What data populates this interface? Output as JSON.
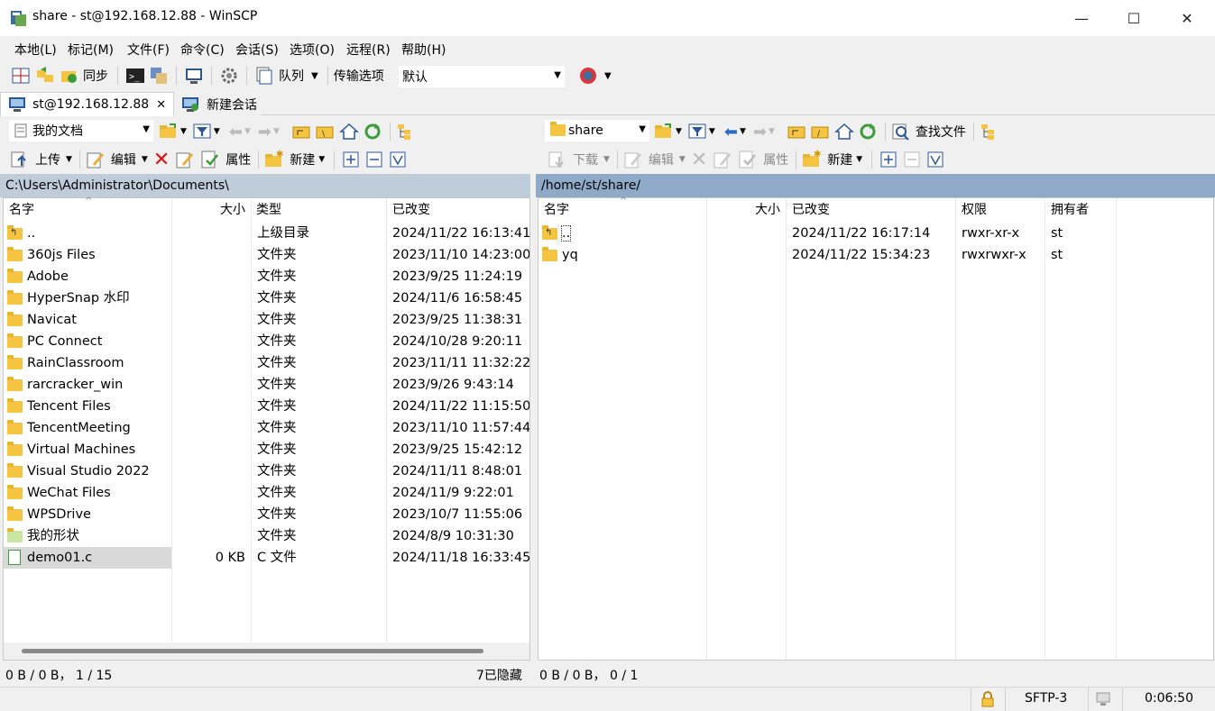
{
  "window": {
    "title": "share - st@192.168.12.88 - WinSCP",
    "minimize": "—",
    "maximize": "☐",
    "close": "✕"
  },
  "menu": [
    "本地(L)",
    "标记(M)",
    "文件(F)",
    "命令(C)",
    "会话(S)",
    "选项(O)",
    "远程(R)",
    "帮助(H)"
  ],
  "toolbar": {
    "sync": "同步",
    "queue": "队列",
    "transfer_label": "传输选项",
    "transfer_value": "默认"
  },
  "tabs": {
    "session": "st@192.168.12.88",
    "session_close": "✕",
    "new_session": "新建会话"
  },
  "local": {
    "combo": "我的文档",
    "upload": "上传",
    "edit": "编辑",
    "props": "属性",
    "new": "新建",
    "path": "C:\\Users\\Administrator\\Documents\\",
    "columns": {
      "name": "名字",
      "size": "大小",
      "type": "类型",
      "changed": "已改变"
    },
    "rows": [
      {
        "name": "..",
        "size": "",
        "type": "上级目录",
        "changed": "2024/11/22  16:13:41",
        "icon": "parent-dir"
      },
      {
        "name": "360js Files",
        "size": "",
        "type": "文件夹",
        "changed": "2023/11/10  14:23:00",
        "icon": "folder"
      },
      {
        "name": "Adobe",
        "size": "",
        "type": "文件夹",
        "changed": "2023/9/25  11:24:19",
        "icon": "folder"
      },
      {
        "name": "HyperSnap 水印",
        "size": "",
        "type": "文件夹",
        "changed": "2024/11/6  16:58:45",
        "icon": "folder"
      },
      {
        "name": "Navicat",
        "size": "",
        "type": "文件夹",
        "changed": "2023/9/25  11:38:31",
        "icon": "folder"
      },
      {
        "name": "PC Connect",
        "size": "",
        "type": "文件夹",
        "changed": "2024/10/28  9:20:11",
        "icon": "folder"
      },
      {
        "name": "RainClassroom",
        "size": "",
        "type": "文件夹",
        "changed": "2023/11/11  11:32:22",
        "icon": "folder"
      },
      {
        "name": "rarcracker_win",
        "size": "",
        "type": "文件夹",
        "changed": "2023/9/26  9:43:14",
        "icon": "folder"
      },
      {
        "name": "Tencent Files",
        "size": "",
        "type": "文件夹",
        "changed": "2024/11/22  11:15:50",
        "icon": "folder"
      },
      {
        "name": "TencentMeeting",
        "size": "",
        "type": "文件夹",
        "changed": "2023/11/10  11:57:44",
        "icon": "folder"
      },
      {
        "name": "Virtual Machines",
        "size": "",
        "type": "文件夹",
        "changed": "2023/9/25  15:42:12",
        "icon": "folder"
      },
      {
        "name": "Visual Studio 2022",
        "size": "",
        "type": "文件夹",
        "changed": "2024/11/11  8:48:01",
        "icon": "folder"
      },
      {
        "name": "WeChat Files",
        "size": "",
        "type": "文件夹",
        "changed": "2024/11/9  9:22:01",
        "icon": "folder"
      },
      {
        "name": "WPSDrive",
        "size": "",
        "type": "文件夹",
        "changed": "2023/10/7  11:55:06",
        "icon": "folder"
      },
      {
        "name": "我的形状",
        "size": "",
        "type": "文件夹",
        "changed": "2024/8/9  10:31:30",
        "icon": "special-folder"
      },
      {
        "name": "demo01.c",
        "size": "0 KB",
        "type": "C 文件",
        "changed": "2024/11/18  16:33:45",
        "icon": "c-file"
      }
    ],
    "status_left": "0 B / 0 B， 1 / 15",
    "status_right": "7已隐藏"
  },
  "remote": {
    "combo": "share",
    "download": "下载",
    "edit": "编辑",
    "props": "属性",
    "new": "新建",
    "find": "查找文件",
    "path": "/home/st/share/",
    "columns": {
      "name": "名字",
      "size": "大小",
      "changed": "已改变",
      "rights": "权限",
      "owner": "拥有者"
    },
    "rows": [
      {
        "name": "..",
        "size": "",
        "changed": "2024/11/22 16:17:14",
        "rights": "rwxr-xr-x",
        "owner": "st",
        "icon": "parent-dir"
      },
      {
        "name": "yq",
        "size": "",
        "changed": "2024/11/22 15:34:23",
        "rights": "rwxrwxr-x",
        "owner": "st",
        "icon": "folder"
      }
    ],
    "status": "0 B / 0 B， 0 / 1"
  },
  "statusbar": {
    "protocol": "SFTP-3",
    "time": "0:06:50"
  },
  "colors": {
    "local_path_bg": "#bfcddb",
    "remote_path_bg": "#8eaac8",
    "selected_row": "#d9d9d9",
    "folder": "#f5c542"
  }
}
